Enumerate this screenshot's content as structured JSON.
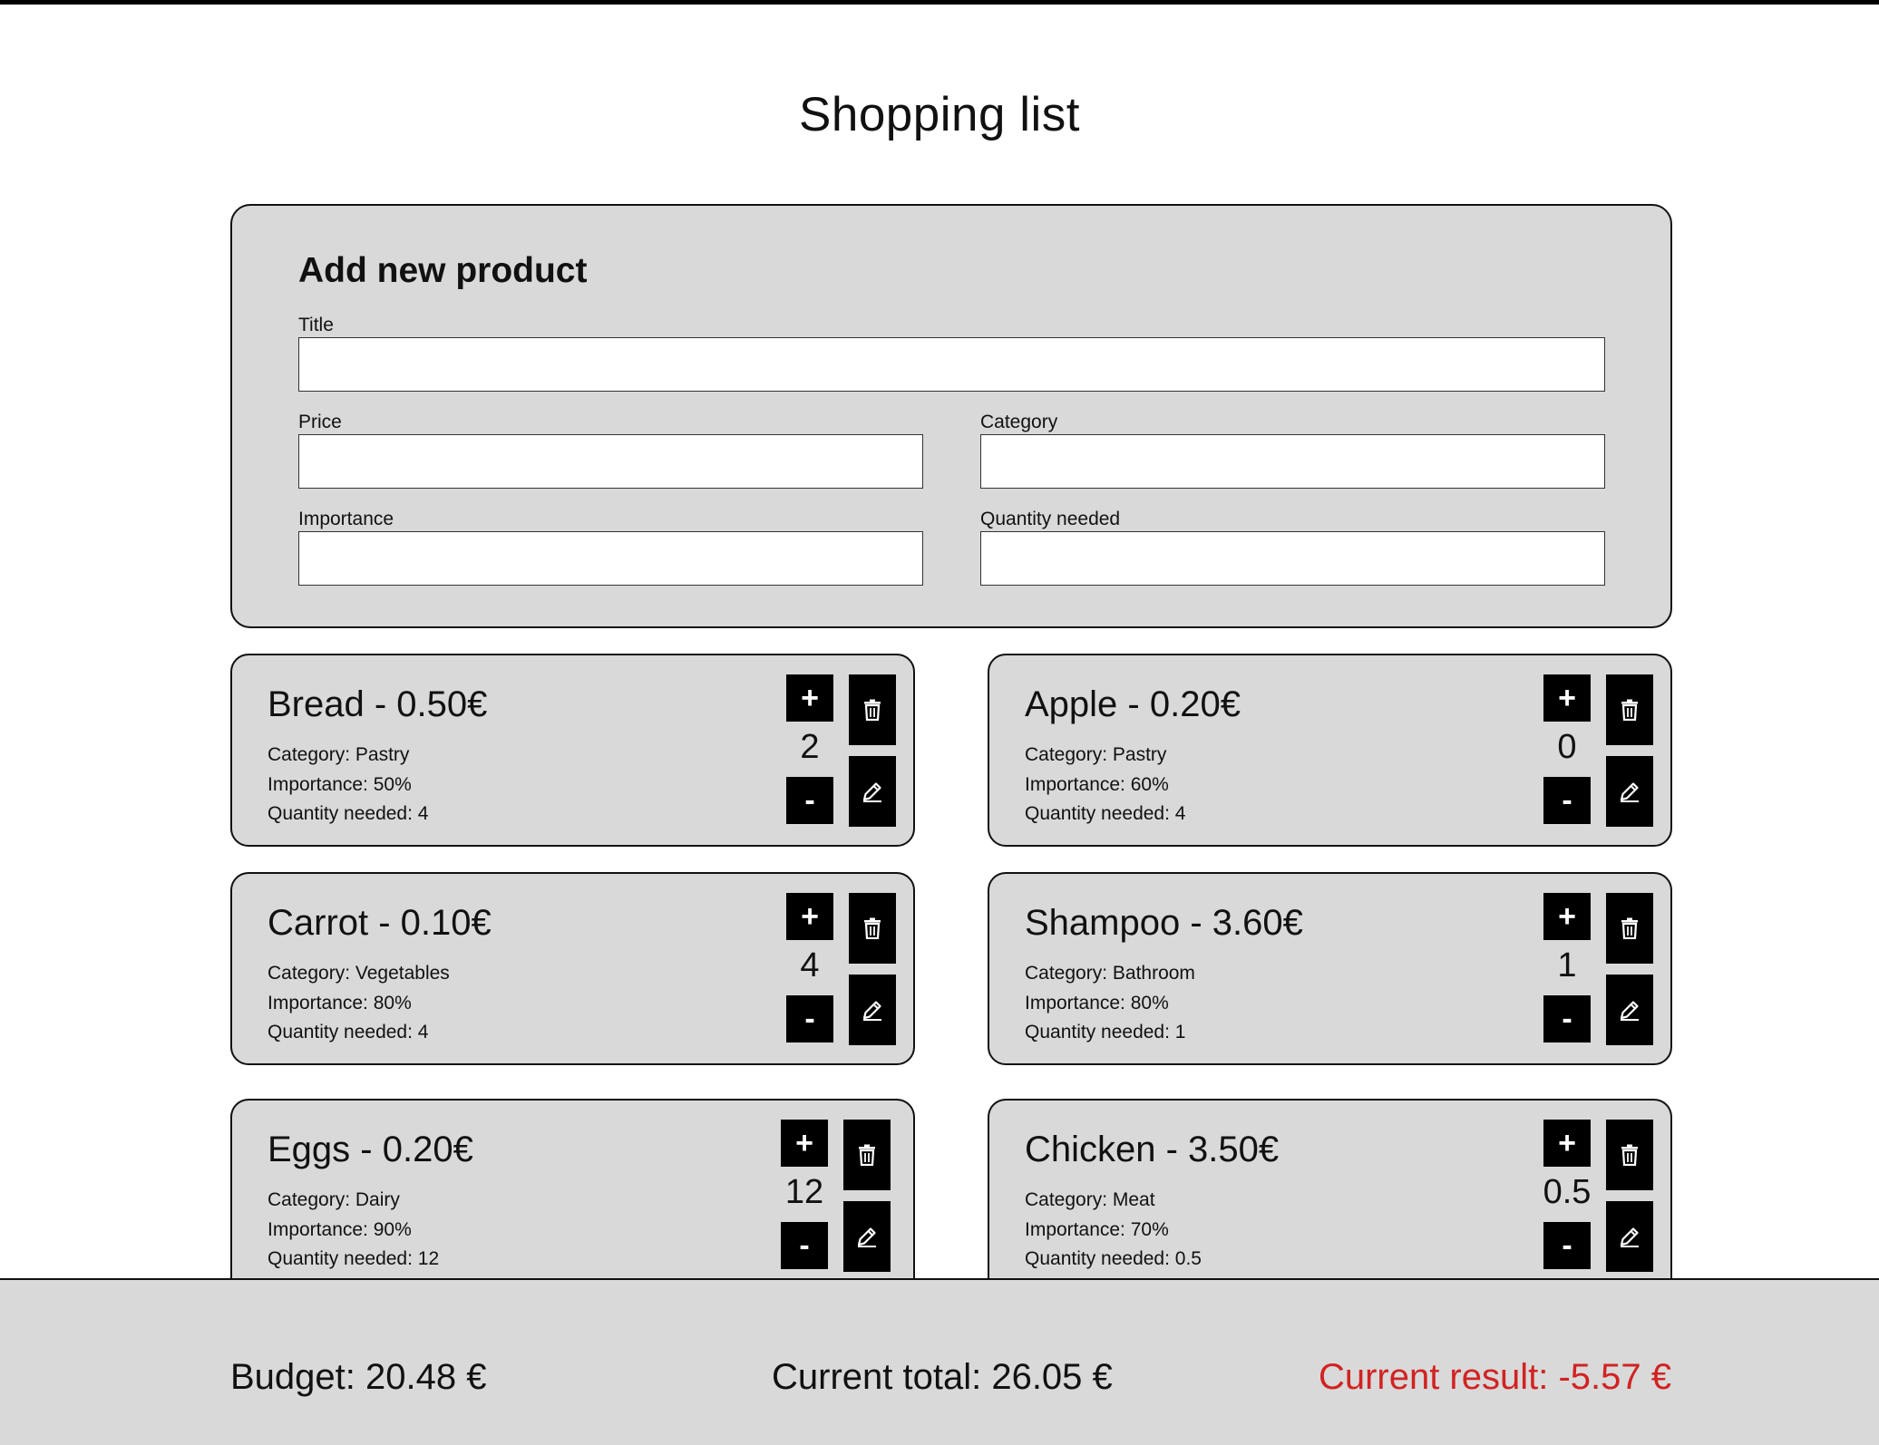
{
  "page": {
    "title": "Shopping list"
  },
  "form": {
    "heading": "Add new product",
    "fields": {
      "title": {
        "label": "Title",
        "value": ""
      },
      "price": {
        "label": "Price",
        "value": ""
      },
      "category": {
        "label": "Category",
        "value": ""
      },
      "importance": {
        "label": "Importance",
        "value": ""
      },
      "quantity": {
        "label": "Quantity needed",
        "value": ""
      }
    }
  },
  "products": [
    {
      "title": "Bread - 0.50€",
      "category": "Category: Pastry",
      "importance": "Importance: 50%",
      "quantity_needed": "Quantity needed: 4",
      "count": "2"
    },
    {
      "title": "Apple - 0.20€",
      "category": "Category: Pastry",
      "importance": "Importance: 60%",
      "quantity_needed": "Quantity needed: 4",
      "count": "0"
    },
    {
      "title": "Carrot - 0.10€",
      "category": "Category: Vegetables",
      "importance": "Importance: 80%",
      "quantity_needed": "Quantity needed: 4",
      "count": "4"
    },
    {
      "title": "Shampoo - 3.60€",
      "category": "Category: Bathroom",
      "importance": "Importance: 80%",
      "quantity_needed": "Quantity needed: 1",
      "count": "1"
    },
    {
      "title": "Eggs - 0.20€",
      "category": "Category: Dairy",
      "importance": "Importance: 90%",
      "quantity_needed": "Quantity needed: 12",
      "count": "12"
    },
    {
      "title": "Chicken - 3.50€",
      "category": "Category: Meat",
      "importance": "Importance: 70%",
      "quantity_needed": "Quantity needed: 0.5",
      "count": "0.5"
    }
  ],
  "controls": {
    "plus_label": "+",
    "minus_label": "-",
    "delete_icon": "trash-icon",
    "edit_icon": "pencil-icon"
  },
  "footer": {
    "budget": "Budget: 20.48 €",
    "current_total": "Current total: 26.05 €",
    "current_result": "Current result: -5.57 €"
  },
  "colors": {
    "panel": "#d9d9d9",
    "button": "#000000",
    "negative": "#d22222"
  }
}
